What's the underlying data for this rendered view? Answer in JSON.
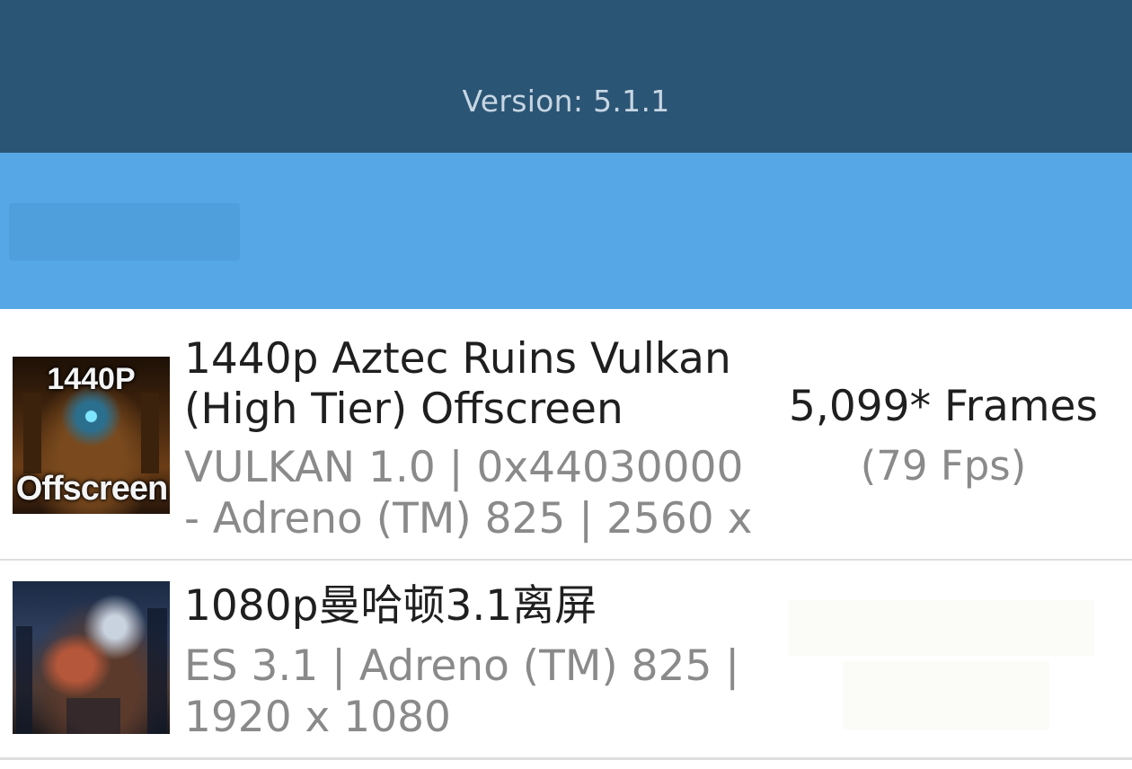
{
  "header": {
    "version_text": "Version: 5.1.1"
  },
  "results": [
    {
      "thumb_top": "1440P",
      "thumb_bottom": "Offscreen",
      "title_line1": "1440p Aztec Ruins Vulkan",
      "title_line2": "(High Tier) Offscreen",
      "detail_line1": "VULKAN 1.0 | 0x44030000",
      "detail_line2": "- Adreno (TM) 825 | 2560 x",
      "score": "5,099* Frames",
      "fps": "(79 Fps)"
    },
    {
      "title_line1": "1080p曼哈顿3.1离屏",
      "detail_line1": "ES 3.1 | Adreno (TM) 825 |",
      "detail_line2": "1920 x 1080"
    }
  ]
}
